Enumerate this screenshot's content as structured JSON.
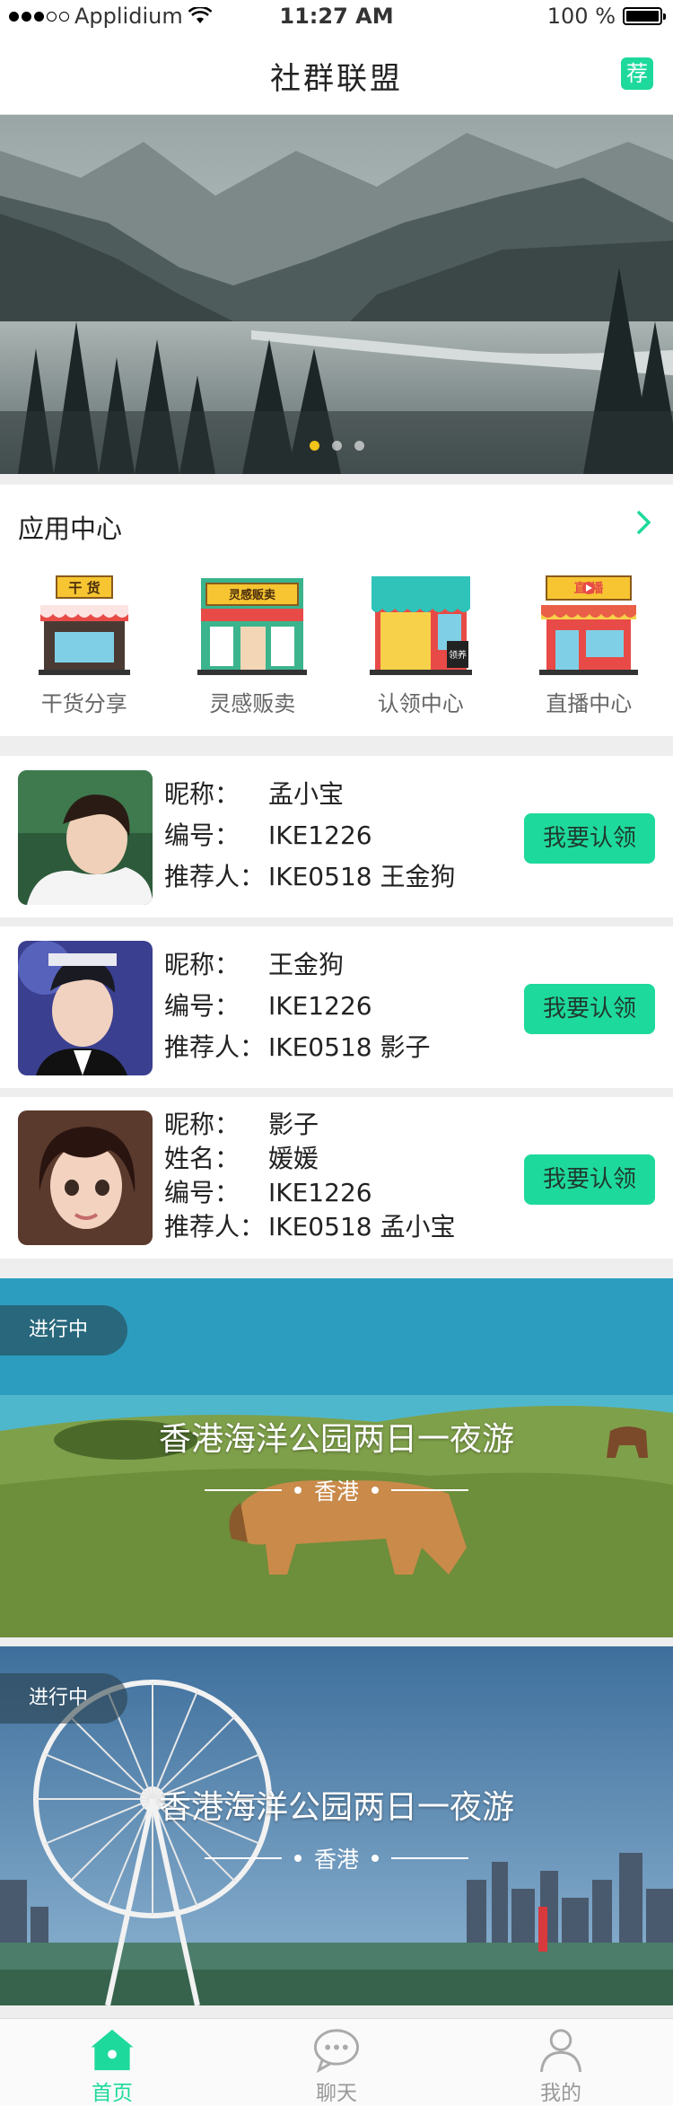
{
  "status_bar": {
    "carrier": "Applidium",
    "time": "11:27 AM",
    "battery": "100 %"
  },
  "nav": {
    "title": "社群联盟",
    "recommend": "荐"
  },
  "app_center": {
    "title": "应用中心",
    "apps": [
      {
        "label": "干货分享",
        "sign": "干 货"
      },
      {
        "label": "灵感贩卖",
        "sign": "灵感贩卖"
      },
      {
        "label": "认领中心",
        "sign": "领养"
      },
      {
        "label": "直播中心",
        "sign": "直 播"
      }
    ]
  },
  "members": [
    {
      "rows": [
        {
          "k": "昵称：",
          "v": "孟小宝"
        },
        {
          "k": "编号：",
          "v": "IKE1226"
        },
        {
          "k": "推荐人：",
          "v": "IKE0518   王金狗"
        }
      ],
      "button": "我要认领"
    },
    {
      "rows": [
        {
          "k": "昵称：",
          "v": "王金狗"
        },
        {
          "k": "编号：",
          "v": "IKE1226"
        },
        {
          "k": "推荐人：",
          "v": "IKE0518   影子"
        }
      ],
      "button": "我要认领"
    },
    {
      "rows": [
        {
          "k": "昵称：",
          "v": "影子"
        },
        {
          "k": "姓名：",
          "v": "媛媛"
        },
        {
          "k": "编号：",
          "v": "IKE1226"
        },
        {
          "k": "推荐人：",
          "v": "IKE0518   孟小宝"
        }
      ],
      "button": "我要认领"
    }
  ],
  "trips": [
    {
      "badge": "进行中",
      "title": "香港海洋公园两日一夜游",
      "location": "香港"
    },
    {
      "badge": "进行中",
      "title": "香港海洋公园两日一夜游",
      "location": "香港"
    }
  ],
  "tabs": [
    {
      "label": "首页",
      "icon": "home-icon",
      "active": true
    },
    {
      "label": "聊天",
      "icon": "chat-icon",
      "active": false
    },
    {
      "label": "我的",
      "icon": "profile-icon",
      "active": false
    }
  ],
  "colors": {
    "accent": "#1ed99c"
  }
}
